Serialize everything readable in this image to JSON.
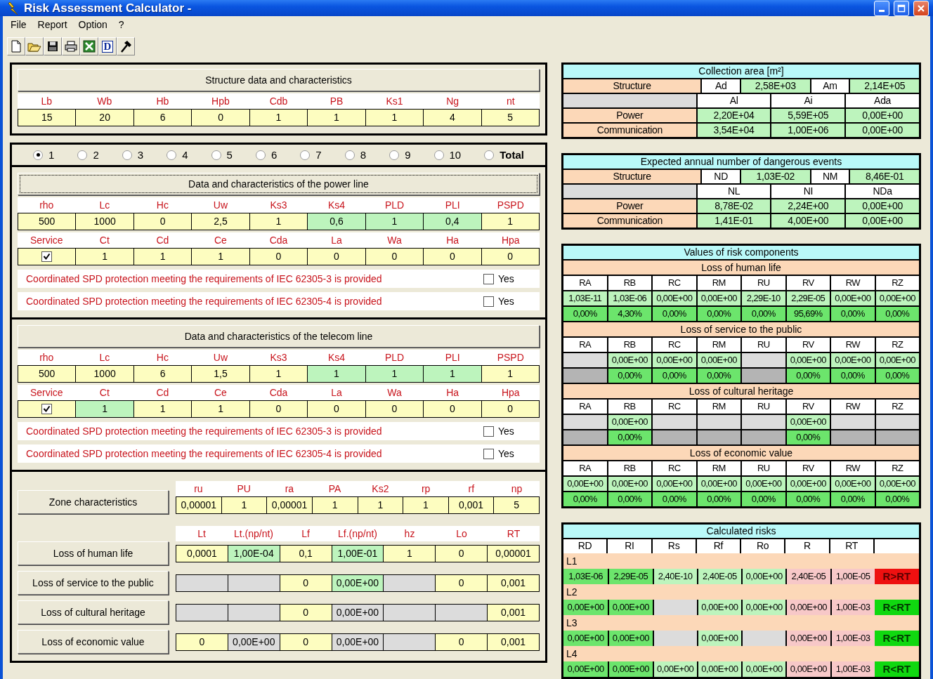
{
  "window": {
    "title": "Risk Assessment Calculator -"
  },
  "menu": [
    "File",
    "Report",
    "Option",
    "?"
  ],
  "toolbar": [
    {
      "kind": "new"
    },
    {
      "kind": "open"
    },
    {
      "kind": "save"
    },
    {
      "kind": "print"
    },
    {
      "kind": "sheet"
    },
    {
      "kind": "letter",
      "label": "D"
    },
    {
      "kind": "tool"
    }
  ],
  "structure": {
    "button": "Structure data and characteristics",
    "fields": [
      {
        "label": "Lb",
        "value": "15",
        "kind": "input"
      },
      {
        "label": "Wb",
        "value": "20",
        "kind": "input"
      },
      {
        "label": "Hb",
        "value": "6",
        "kind": "input"
      },
      {
        "label": "Hpb",
        "value": "0",
        "kind": "input"
      },
      {
        "label": "Cdb",
        "value": "1",
        "kind": "input"
      },
      {
        "label": "PB",
        "value": "1",
        "kind": "input"
      },
      {
        "label": "Ks1",
        "value": "1",
        "kind": "input"
      },
      {
        "label": "Ng",
        "value": "4",
        "kind": "input"
      },
      {
        "label": "nt",
        "value": "5",
        "kind": "input"
      }
    ]
  },
  "zones": [
    {
      "label": "1",
      "selected": true,
      "kind": "number"
    },
    {
      "label": "2",
      "selected": false,
      "kind": "number"
    },
    {
      "label": "3",
      "selected": false,
      "kind": "number"
    },
    {
      "label": "4",
      "selected": false,
      "kind": "number"
    },
    {
      "label": "5",
      "selected": false,
      "kind": "number"
    },
    {
      "label": "6",
      "selected": false,
      "kind": "number"
    },
    {
      "label": "7",
      "selected": false,
      "kind": "number"
    },
    {
      "label": "8",
      "selected": false,
      "kind": "number"
    },
    {
      "label": "9",
      "selected": false,
      "kind": "number"
    },
    {
      "label": "10",
      "selected": false,
      "kind": "number"
    },
    {
      "label": "Total",
      "selected": false,
      "kind": "total"
    }
  ],
  "lines": [
    {
      "button": "Data and characteristics of the power line",
      "focused": true,
      "params": [
        {
          "label": "rho",
          "value": "500",
          "kind": "input"
        },
        {
          "label": "Lc",
          "value": "1000",
          "kind": "input"
        },
        {
          "label": "Hc",
          "value": "0",
          "kind": "input"
        },
        {
          "label": "Uw",
          "value": "2,5",
          "kind": "input"
        },
        {
          "label": "Ks3",
          "value": "1",
          "kind": "input"
        },
        {
          "label": "Ks4",
          "value": "0,6",
          "kind": "computed"
        },
        {
          "label": "PLD",
          "value": "1",
          "kind": "computed"
        },
        {
          "label": "PLI",
          "value": "0,4",
          "kind": "computed"
        },
        {
          "label": "PSPD",
          "value": "1",
          "kind": "input"
        }
      ],
      "service": {
        "label": "Service",
        "checked": true
      },
      "extras": [
        {
          "label": "Ct",
          "value": "1",
          "kind": "input"
        },
        {
          "label": "Cd",
          "value": "1",
          "kind": "input"
        },
        {
          "label": "Ce",
          "value": "1",
          "kind": "input"
        },
        {
          "label": "Cda",
          "value": "0",
          "kind": "input"
        },
        {
          "label": "La",
          "value": "0",
          "kind": "input"
        },
        {
          "label": "Wa",
          "value": "0",
          "kind": "input"
        },
        {
          "label": "Ha",
          "value": "0",
          "kind": "input"
        },
        {
          "label": "Hpa",
          "value": "0",
          "kind": "input"
        }
      ],
      "spd": [
        {
          "text": "Coordinated SPD protection meeting the requirements of IEC 62305-3 is provided",
          "option": "Yes",
          "checked": false
        },
        {
          "text": "Coordinated SPD protection meeting the requirements of IEC 62305-4 is provided",
          "option": "Yes",
          "checked": false
        }
      ]
    },
    {
      "button": "Data and characteristics of the telecom line",
      "focused": false,
      "params": [
        {
          "label": "rho",
          "value": "500",
          "kind": "input"
        },
        {
          "label": "Lc",
          "value": "1000",
          "kind": "input"
        },
        {
          "label": "Hc",
          "value": "6",
          "kind": "input"
        },
        {
          "label": "Uw",
          "value": "1,5",
          "kind": "input"
        },
        {
          "label": "Ks3",
          "value": "1",
          "kind": "input"
        },
        {
          "label": "Ks4",
          "value": "1",
          "kind": "computed"
        },
        {
          "label": "PLD",
          "value": "1",
          "kind": "computed"
        },
        {
          "label": "PLI",
          "value": "1",
          "kind": "computed"
        },
        {
          "label": "PSPD",
          "value": "1",
          "kind": "input"
        }
      ],
      "service": {
        "label": "Service",
        "checked": true
      },
      "extras": [
        {
          "label": "Ct",
          "value": "1",
          "kind": "computed"
        },
        {
          "label": "Cd",
          "value": "1",
          "kind": "input"
        },
        {
          "label": "Ce",
          "value": "1",
          "kind": "input"
        },
        {
          "label": "Cda",
          "value": "0",
          "kind": "input"
        },
        {
          "label": "La",
          "value": "0",
          "kind": "input"
        },
        {
          "label": "Wa",
          "value": "0",
          "kind": "input"
        },
        {
          "label": "Ha",
          "value": "0",
          "kind": "input"
        },
        {
          "label": "Hpa",
          "value": "0",
          "kind": "input"
        }
      ],
      "spd": [
        {
          "text": "Coordinated SPD protection meeting the requirements of IEC 62305-3 is provided",
          "option": "Yes",
          "checked": false
        },
        {
          "text": "Coordinated SPD protection meeting the requirements of IEC 62305-4 is provided",
          "option": "Yes",
          "checked": false
        }
      ]
    }
  ],
  "zone": {
    "button": "Zone characteristics",
    "fields": [
      {
        "label": "ru",
        "value": "0,00001",
        "kind": "input"
      },
      {
        "label": "PU",
        "value": "1",
        "kind": "input"
      },
      {
        "label": "ra",
        "value": "0,00001",
        "kind": "input"
      },
      {
        "label": "PA",
        "value": "1",
        "kind": "input"
      },
      {
        "label": "Ks2",
        "value": "1",
        "kind": "input"
      },
      {
        "label": "rp",
        "value": "1",
        "kind": "input"
      },
      {
        "label": "rf",
        "value": "0,001",
        "kind": "input"
      },
      {
        "label": "np",
        "value": "5",
        "kind": "input"
      }
    ]
  },
  "losses": {
    "columns": [
      "Lt",
      "Lt.(np/nt)",
      "Lf",
      "Lf.(np/nt)",
      "hz",
      "Lo",
      "RT"
    ],
    "rows": [
      {
        "button": "Loss of human life",
        "cells": [
          {
            "value": "0,0001",
            "kind": "input"
          },
          {
            "value": "1,00E-04",
            "kind": "computed"
          },
          {
            "value": "0,1",
            "kind": "input"
          },
          {
            "value": "1,00E-01",
            "kind": "computed"
          },
          {
            "value": "1",
            "kind": "input"
          },
          {
            "value": "0",
            "kind": "input"
          },
          {
            "value": "0,00001",
            "kind": "input"
          }
        ]
      },
      {
        "button": "Loss of service to the public",
        "cells": [
          {
            "kind": "disabled"
          },
          {
            "kind": "disabled"
          },
          {
            "value": "0",
            "kind": "input"
          },
          {
            "value": "0,00E+00",
            "kind": "computed"
          },
          {
            "kind": "disabled"
          },
          {
            "value": "0",
            "kind": "input"
          },
          {
            "value": "0,001",
            "kind": "input"
          }
        ]
      },
      {
        "button": "Loss of cultural heritage",
        "cells": [
          {
            "kind": "disabled"
          },
          {
            "kind": "disabled"
          },
          {
            "value": "0",
            "kind": "input"
          },
          {
            "value": "0,00E+00",
            "kind": "disabled"
          },
          {
            "kind": "disabled"
          },
          {
            "kind": "disabled"
          },
          {
            "value": "0,001",
            "kind": "input"
          }
        ]
      },
      {
        "button": "Loss of economic value",
        "cells": [
          {
            "value": "0",
            "kind": "input"
          },
          {
            "value": "0,00E+00",
            "kind": "disabled"
          },
          {
            "value": "0",
            "kind": "input"
          },
          {
            "value": "0,00E+00",
            "kind": "disabled"
          },
          {
            "kind": "disabled"
          },
          {
            "value": "0",
            "kind": "input"
          },
          {
            "value": "0,001",
            "kind": "input"
          }
        ]
      }
    ]
  },
  "collection_area": {
    "title": "Collection area [m²]",
    "structure": {
      "label": "Structure",
      "pairs": [
        {
          "label": "Ad",
          "value": "2,58E+03"
        },
        {
          "label": "Am",
          "value": "2,14E+05"
        }
      ]
    },
    "columns": [
      "Al",
      "Ai",
      "Ada"
    ],
    "rows": [
      {
        "label": "Power",
        "values": [
          "2,20E+04",
          "5,59E+05",
          "0,00E+00"
        ]
      },
      {
        "label": "Communication",
        "values": [
          "3,54E+04",
          "1,00E+06",
          "0,00E+00"
        ]
      }
    ]
  },
  "dangerous_events": {
    "title": "Expected annual number of dangerous events",
    "structure": {
      "label": "Structure",
      "pairs": [
        {
          "label": "ND",
          "value": "1,03E-02"
        },
        {
          "label": "NM",
          "value": "8,46E-01"
        }
      ]
    },
    "columns": [
      "NL",
      "NI",
      "NDa"
    ],
    "rows": [
      {
        "label": "Power",
        "values": [
          "8,78E-02",
          "2,24E+00",
          "0,00E+00"
        ]
      },
      {
        "label": "Communication",
        "values": [
          "1,41E-01",
          "4,00E+00",
          "0,00E+00"
        ]
      }
    ]
  },
  "risk_components": {
    "title": "Values of risk components",
    "groups": [
      {
        "title": "Loss of human life",
        "columns": [
          "RA",
          "RB",
          "RC",
          "RM",
          "RU",
          "RV",
          "RW",
          "RZ"
        ],
        "values": [
          {
            "kind": "value",
            "text": "1,03E-11"
          },
          {
            "kind": "value",
            "text": "1,03E-06"
          },
          {
            "kind": "value",
            "text": "0,00E+00"
          },
          {
            "kind": "value",
            "text": "0,00E+00"
          },
          {
            "kind": "value",
            "text": "2,29E-10"
          },
          {
            "kind": "value",
            "text": "2,29E-05"
          },
          {
            "kind": "value",
            "text": "0,00E+00"
          },
          {
            "kind": "value",
            "text": "0,00E+00"
          }
        ],
        "shares": [
          {
            "kind": "value",
            "text": "0,00%"
          },
          {
            "kind": "value",
            "text": "4,30%"
          },
          {
            "kind": "value",
            "text": "0,00%"
          },
          {
            "kind": "value",
            "text": "0,00%"
          },
          {
            "kind": "value",
            "text": "0,00%"
          },
          {
            "kind": "value",
            "text": "95,69%"
          },
          {
            "kind": "value",
            "text": "0,00%"
          },
          {
            "kind": "value",
            "text": "0,00%"
          }
        ]
      },
      {
        "title": "Loss of service to the public",
        "columns": [
          "RA",
          "RB",
          "RC",
          "RM",
          "RU",
          "RV",
          "RW",
          "RZ"
        ],
        "values": [
          {
            "kind": "blank"
          },
          {
            "kind": "value",
            "text": "0,00E+00"
          },
          {
            "kind": "value",
            "text": "0,00E+00"
          },
          {
            "kind": "value",
            "text": "0,00E+00"
          },
          {
            "kind": "blank"
          },
          {
            "kind": "value",
            "text": "0,00E+00"
          },
          {
            "kind": "value",
            "text": "0,00E+00"
          },
          {
            "kind": "value",
            "text": "0,00E+00"
          }
        ],
        "shares": [
          {
            "kind": "blank"
          },
          {
            "kind": "value",
            "text": "0,00%"
          },
          {
            "kind": "value",
            "text": "0,00%"
          },
          {
            "kind": "value",
            "text": "0,00%"
          },
          {
            "kind": "blank"
          },
          {
            "kind": "value",
            "text": "0,00%"
          },
          {
            "kind": "value",
            "text": "0,00%"
          },
          {
            "kind": "value",
            "text": "0,00%"
          }
        ]
      },
      {
        "title": "Loss of cultural heritage",
        "columns": [
          "RA",
          "RB",
          "RC",
          "RM",
          "RU",
          "RV",
          "RW",
          "RZ"
        ],
        "values": [
          {
            "kind": "blank"
          },
          {
            "kind": "value",
            "text": "0,00E+00"
          },
          {
            "kind": "blank"
          },
          {
            "kind": "blank"
          },
          {
            "kind": "blank"
          },
          {
            "kind": "value",
            "text": "0,00E+00"
          },
          {
            "kind": "blank"
          },
          {
            "kind": "blank"
          }
        ],
        "shares": [
          {
            "kind": "blank"
          },
          {
            "kind": "value",
            "text": "0,00%"
          },
          {
            "kind": "blank"
          },
          {
            "kind": "blank"
          },
          {
            "kind": "blank"
          },
          {
            "kind": "value",
            "text": "0,00%"
          },
          {
            "kind": "blank"
          },
          {
            "kind": "blank"
          }
        ]
      },
      {
        "title": "Loss of economic value",
        "columns": [
          "RA",
          "RB",
          "RC",
          "RM",
          "RU",
          "RV",
          "RW",
          "RZ"
        ],
        "values": [
          {
            "kind": "value",
            "text": "0,00E+00"
          },
          {
            "kind": "value",
            "text": "0,00E+00"
          },
          {
            "kind": "value",
            "text": "0,00E+00"
          },
          {
            "kind": "value",
            "text": "0,00E+00"
          },
          {
            "kind": "value",
            "text": "0,00E+00"
          },
          {
            "kind": "value",
            "text": "0,00E+00"
          },
          {
            "kind": "value",
            "text": "0,00E+00"
          },
          {
            "kind": "value",
            "text": "0,00E+00"
          }
        ],
        "shares": [
          {
            "kind": "value",
            "text": "0,00%"
          },
          {
            "kind": "value",
            "text": "0,00%"
          },
          {
            "kind": "value",
            "text": "0,00%"
          },
          {
            "kind": "value",
            "text": "0,00%"
          },
          {
            "kind": "value",
            "text": "0,00%"
          },
          {
            "kind": "value",
            "text": "0,00%"
          },
          {
            "kind": "value",
            "text": "0,00%"
          },
          {
            "kind": "value",
            "text": "0,00%"
          }
        ]
      }
    ]
  },
  "calculated_risks": {
    "title": "Calculated risks",
    "columns": [
      {
        "label": "RD",
        "kind": "strong"
      },
      {
        "label": "RI",
        "kind": "strong"
      },
      {
        "label": "Rs",
        "kind": "light"
      },
      {
        "label": "Rf",
        "kind": "light"
      },
      {
        "label": "Ro",
        "kind": "light"
      },
      {
        "label": "R",
        "kind": "risk"
      },
      {
        "label": "RT",
        "kind": "risk"
      }
    ],
    "rows": [
      {
        "label": "L1",
        "values": [
          {
            "kind": "value",
            "text": "1,03E-06"
          },
          {
            "kind": "value",
            "text": "2,29E-05"
          },
          {
            "kind": "value",
            "text": "2,40E-10"
          },
          {
            "kind": "value",
            "text": "2,40E-05"
          },
          {
            "kind": "value",
            "text": "0,00E+00"
          },
          {
            "kind": "value",
            "text": "2,40E-05"
          },
          {
            "kind": "value",
            "text": "1,00E-05"
          }
        ],
        "verdict": {
          "text": "R>RT",
          "exceeded": true
        }
      },
      {
        "label": "L2",
        "values": [
          {
            "kind": "value",
            "text": "0,00E+00"
          },
          {
            "kind": "value",
            "text": "0,00E+00"
          },
          {
            "kind": "blank"
          },
          {
            "kind": "value",
            "text": "0,00E+00"
          },
          {
            "kind": "value",
            "text": "0,00E+00"
          },
          {
            "kind": "value",
            "text": "0,00E+00"
          },
          {
            "kind": "value",
            "text": "1,00E-03"
          }
        ],
        "verdict": {
          "text": "R<RT",
          "exceeded": false
        }
      },
      {
        "label": "L3",
        "values": [
          {
            "kind": "value",
            "text": "0,00E+00"
          },
          {
            "kind": "value",
            "text": "0,00E+00"
          },
          {
            "kind": "blank"
          },
          {
            "kind": "value",
            "text": "0,00E+00"
          },
          {
            "kind": "blank"
          },
          {
            "kind": "value",
            "text": "0,00E+00"
          },
          {
            "kind": "value",
            "text": "1,00E-03"
          }
        ],
        "verdict": {
          "text": "R<RT",
          "exceeded": false
        }
      },
      {
        "label": "L4",
        "values": [
          {
            "kind": "value",
            "text": "0,00E+00"
          },
          {
            "kind": "value",
            "text": "0,00E+00"
          },
          {
            "kind": "value",
            "text": "0,00E+00"
          },
          {
            "kind": "value",
            "text": "0,00E+00"
          },
          {
            "kind": "value",
            "text": "0,00E+00"
          },
          {
            "kind": "value",
            "text": "0,00E+00"
          },
          {
            "kind": "value",
            "text": "1,00E-03"
          }
        ],
        "verdict": {
          "text": "R<RT",
          "exceeded": false
        }
      }
    ]
  }
}
